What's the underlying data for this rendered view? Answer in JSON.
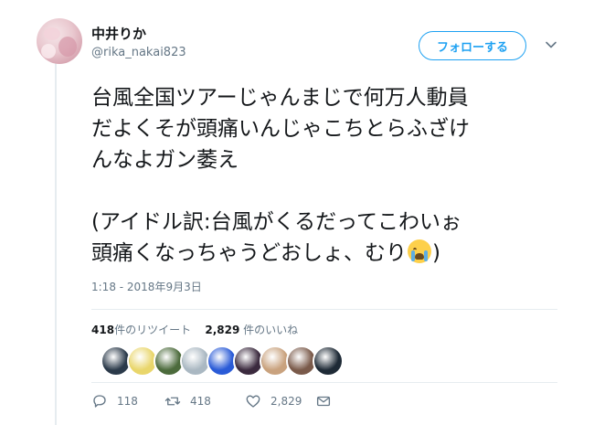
{
  "user": {
    "name": "中井りか",
    "handle": "@rika_nakai823"
  },
  "follow_label": "フォローする",
  "tweet": {
    "line1": "台風全国ツアーじゃんまじで何万人動員",
    "line2": "だよくそが頭痛いんじゃこちとらふざけ",
    "line3": "んなよガン萎え",
    "line4": "(アイドル訳:台風がくるだってこわいぉ",
    "line5_pre": "頭痛くなっちゃうどおしょ、むり",
    "line5_post": ")",
    "emoji": "loudly-crying-face"
  },
  "timestamp": "1:18 - 2018年9月3日",
  "stats": {
    "retweets_count": "418",
    "retweets_label": "件のリツイート",
    "likes_count": "2,829",
    "likes_label": "件のいいね"
  },
  "likers": [
    {
      "name": "liker-1",
      "color": "#2b3a4a"
    },
    {
      "name": "liker-2",
      "color": "#e9d66b"
    },
    {
      "name": "liker-3",
      "color": "#4c6b3c"
    },
    {
      "name": "liker-4",
      "color": "#aab8c2"
    },
    {
      "name": "liker-5",
      "color": "#2a5bd7"
    },
    {
      "name": "liker-6",
      "color": "#3b2a3e"
    },
    {
      "name": "liker-7",
      "color": "#c9a27e"
    },
    {
      "name": "liker-8",
      "color": "#7a5a4a"
    },
    {
      "name": "liker-9",
      "color": "#1e2a36"
    }
  ],
  "actions": {
    "reply_count": "118",
    "retweet_count": "418",
    "like_count": "2,829"
  },
  "colors": {
    "accent": "#1da1f2",
    "muted": "#657786",
    "text": "#14171a"
  }
}
